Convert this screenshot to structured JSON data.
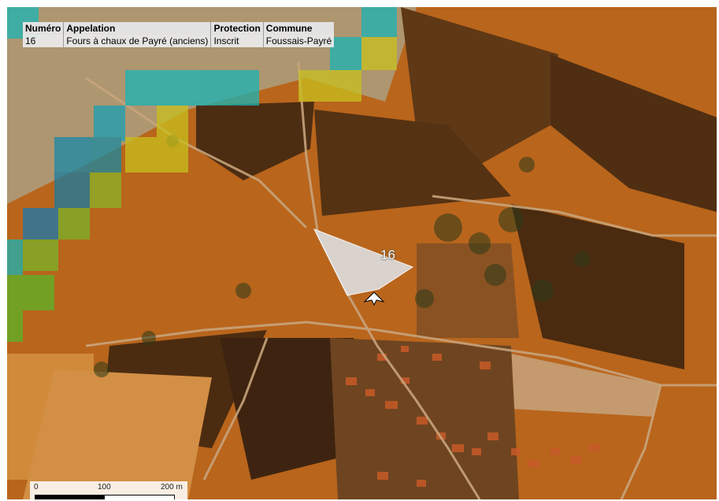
{
  "map": {
    "feature_label": "16",
    "colors": {
      "field_orange": "#c06a1c",
      "field_dark": "#5a3414",
      "overlay_teal": "#19b4b4",
      "overlay_yellow": "#c8c01e",
      "polygon_fill": "#dcdcdc"
    },
    "icons": [
      "north-arrow-icon",
      "site-polygon"
    ]
  },
  "attribute_table": {
    "headers": [
      "Numéro",
      "Appelation",
      "Protection",
      "Commune"
    ],
    "rows": [
      [
        "16",
        "Fours à chaux de Payré (anciens)",
        "Inscrit",
        "Foussais-Payré"
      ]
    ]
  },
  "scale_bar": {
    "labels": [
      "0",
      "100",
      "200 m"
    ]
  }
}
